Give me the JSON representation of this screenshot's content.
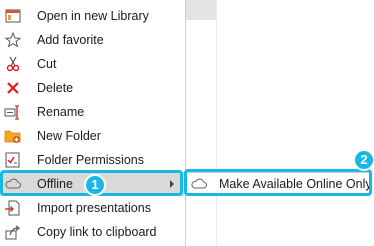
{
  "context_menu": {
    "items": [
      {
        "label": "Open in new Library",
        "icon": "library-window-icon"
      },
      {
        "label": "Add favorite",
        "icon": "star-outline-icon"
      },
      {
        "label": "Cut",
        "icon": "scissors-icon"
      },
      {
        "label": "Delete",
        "icon": "delete-x-icon"
      },
      {
        "label": "Rename",
        "icon": "rename-icon"
      },
      {
        "label": "New Folder",
        "icon": "new-folder-icon"
      },
      {
        "label": "Folder Permissions",
        "icon": "folder-permissions-icon"
      },
      {
        "label": "Offline",
        "icon": "cloud-icon",
        "has_submenu": true,
        "highlighted": true
      },
      {
        "label": "Import presentations",
        "icon": "import-icon"
      },
      {
        "label": "Copy link to clipboard",
        "icon": "share-link-icon"
      }
    ]
  },
  "submenu": {
    "items": [
      {
        "label": "Make Available Online Only",
        "icon": "cloud-icon"
      }
    ]
  },
  "callouts": {
    "step1": "1",
    "step2": "2",
    "color": "#19b7e6"
  },
  "colors": {
    "delete_red": "#e0191e",
    "folder_orange": "#f5a623",
    "highlight_bg": "#d9d9d9"
  }
}
